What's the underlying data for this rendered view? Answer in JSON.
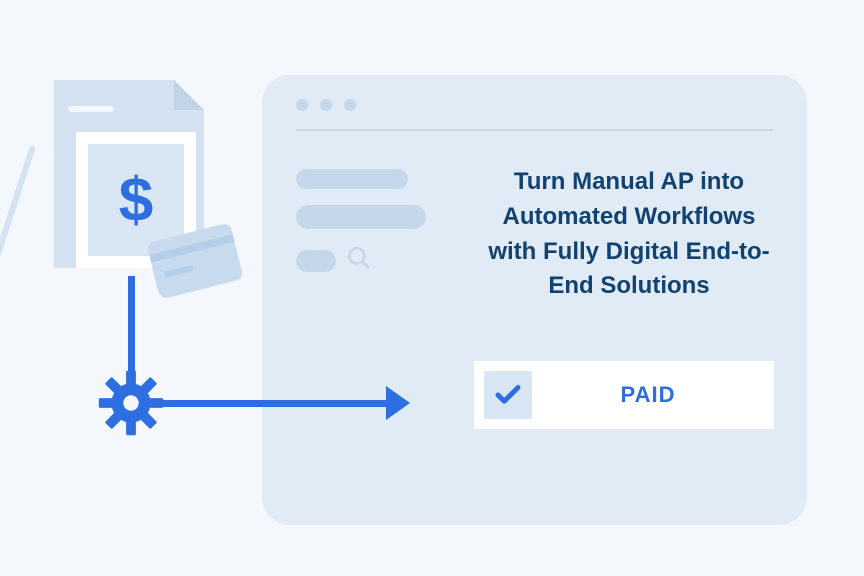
{
  "heading": "Turn Manual AP into Automated Workflows with Fully Digital End-to-End Solutions",
  "status": {
    "label": "PAID"
  },
  "invoice": {
    "currency_symbol": "$"
  },
  "icons": {
    "dollar": "dollar-icon",
    "gear": "gear-icon",
    "arrow": "arrow-right-icon",
    "check": "check-icon",
    "search": "search-icon",
    "pencil": "pencil-icon",
    "card": "credit-card-icon"
  },
  "colors": {
    "accent": "#2d6fe0",
    "dark_text": "#12426f",
    "panel": "#e0ebf6",
    "panel_muted": "#c5d8eb",
    "page_bg": "#f4f7fb"
  }
}
